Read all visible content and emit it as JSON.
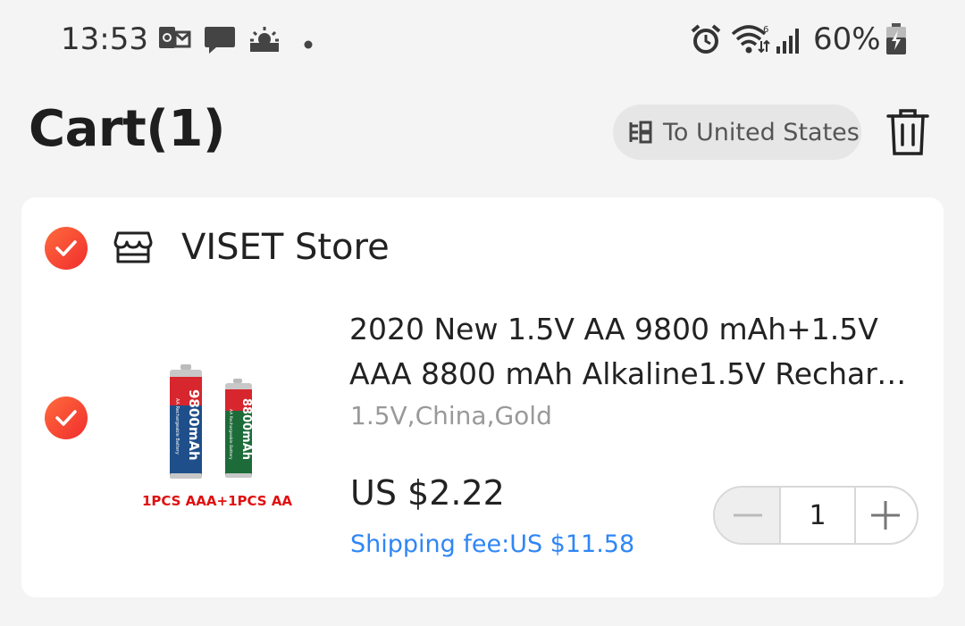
{
  "status_bar": {
    "time": "13:53",
    "battery": "60%",
    "icons": [
      "outlook-icon",
      "message-icon",
      "weather-icon",
      "dot-icon",
      "alarm-icon",
      "wifi-icon",
      "signal-icon",
      "battery-icon"
    ]
  },
  "header": {
    "title": "Cart(1)",
    "ship_to": "To United States",
    "ship_icon": "location-icon",
    "delete_icon": "trash-icon"
  },
  "store": {
    "name": "VISET Store",
    "selected": true
  },
  "item": {
    "selected": true,
    "title_line1": "2020 New 1.5V AA 9800 mAh+1.5V",
    "title_line2": "AAA 8800 mAh Alkaline1.5V Recharg...",
    "variant": "1.5V,China,Gold",
    "price": "US $2.22",
    "shipping": "Shipping fee:US $11.58",
    "quantity": "1",
    "image": {
      "battery_aa_label": "9800mAh",
      "battery_aaa_label": "8800mAh",
      "battery_subtext": "AA Rechargeable Battery",
      "caption": "1PCS AAA+1PCS AA"
    }
  },
  "colors": {
    "accent_red": "#f02d2d",
    "link_blue": "#2f86f6",
    "background": "#f4f4f4"
  }
}
